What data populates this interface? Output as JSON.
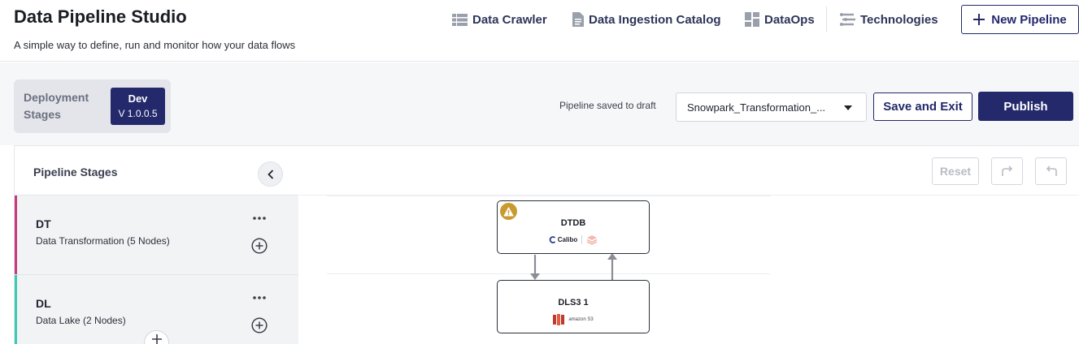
{
  "header": {
    "title": "Data Pipeline Studio",
    "subtitle": "A simple way to define, run and monitor how your data flows",
    "nav": [
      {
        "label": "Data Crawler",
        "icon": "table-list-icon"
      },
      {
        "label": "Data Ingestion Catalog",
        "icon": "document-icon"
      },
      {
        "label": "DataOps",
        "icon": "dashboard-grid-icon"
      },
      {
        "label": "Technologies",
        "icon": "technologies-icon"
      }
    ],
    "new_pipeline_label": "New Pipeline"
  },
  "toolbar": {
    "deployment_label": "Deployment Stages",
    "deployment_env": "Dev",
    "deployment_version": "V 1.0.0.5",
    "draft_status": "Pipeline saved to draft",
    "pipeline_select_value": "Snowpark_Transformation_...",
    "save_exit_label": "Save and Exit",
    "publish_label": "Publish"
  },
  "stages": {
    "title": "Pipeline Stages",
    "items": [
      {
        "code": "DT",
        "description": "Data Transformation (5 Nodes)",
        "color": "#c8397f"
      },
      {
        "code": "DL",
        "description": "Data Lake (2 Nodes)",
        "color": "#3ec9b5"
      }
    ]
  },
  "canvas": {
    "reset_label": "Reset",
    "nodes": [
      {
        "title": "DTDB",
        "logo_text": "Calibo",
        "has_warning": true
      },
      {
        "title": "DLS3 1",
        "logo_text": "amazon S3",
        "has_warning": false
      }
    ]
  },
  "colors": {
    "primary": "#23296b",
    "warning": "#c99a2e",
    "dt_stage": "#c8397f",
    "dl_stage": "#3ec9b5"
  }
}
